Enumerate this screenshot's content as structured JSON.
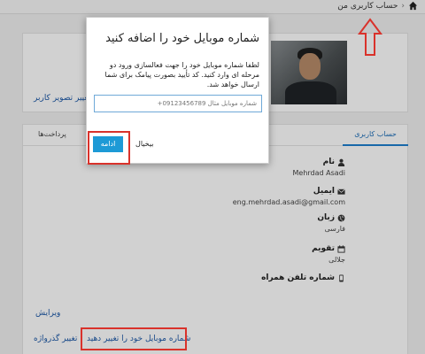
{
  "header": {
    "breadcrumb_root": "حساب کاربری من",
    "separator": "‹"
  },
  "profile": {
    "change_photo_label": "تغییر تصویر کاربر"
  },
  "tabs": {
    "account": "حساب کاربری",
    "payments": "پرداخت‌ها"
  },
  "fields": [
    {
      "label": "نام",
      "value": "Mehrdad Asadi",
      "icon": "user-icon"
    },
    {
      "label": "ایمیل",
      "value": "eng.mehrdad.asadi@gmail.com",
      "icon": "envelope-icon"
    },
    {
      "label": "زبان",
      "value": "فارسی",
      "icon": "globe-icon"
    },
    {
      "label": "تقویم",
      "value": "جلالی",
      "icon": "calendar-icon"
    },
    {
      "label": "شماره تلفن همراه",
      "value": "",
      "icon": "mobile-icon"
    }
  ],
  "actions": {
    "edit": "ویرایش",
    "change_password": "تغییر گذرواژه",
    "change_mobile": "شماره موبایل خود را تغییر دهید"
  },
  "modal": {
    "title": "شماره موبایل خود را اضافه کنید",
    "body": "لطفا شماره موبایل خود را جهت فعالسازی ورود دو مرحله ای وارد کنید. کد تأیید بصورت پیامک برای شما ارسال خواهد شد.",
    "input_placeholder": "شماره موبایل مثال 09123456789+",
    "continue_label": "ادامه",
    "cancel_label": "بیخیال"
  },
  "colors": {
    "accent": "#1d9ad6",
    "link": "#1e5aa8",
    "highlight": "#d9322b"
  }
}
